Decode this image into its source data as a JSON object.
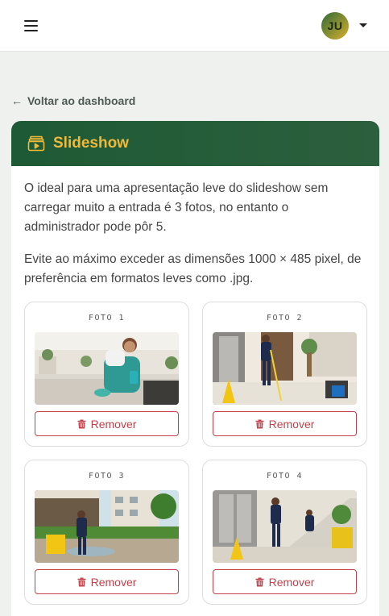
{
  "topbar": {
    "menu_icon": "hamburger-menu-icon",
    "avatar_initials": "JU",
    "dropdown_icon": "caret-down-icon"
  },
  "back_link": {
    "arrow": "←",
    "label": "Voltar ao dashboard"
  },
  "card": {
    "title": "Slideshow",
    "title_icon": "slideshow-icon",
    "header_color": "#1e5a35",
    "title_color": "#f0b93a",
    "description_1": "O ideal para uma apresentação leve do slideshow sem carregar muito a entrada é 3 fotos, no entanto o administrador pode pôr 5.",
    "description_2": "Evite ao máximo exceder as dimensões 1000 × 485 pixel, de preferência em formatos leves como .jpg."
  },
  "photos": [
    {
      "label": "FOTO 1",
      "remove_label": "Remover"
    },
    {
      "label": "FOTO 2",
      "remove_label": "Remover"
    },
    {
      "label": "FOTO 3",
      "remove_label": "Remover"
    },
    {
      "label": "FOTO 4",
      "remove_label": "Remover"
    }
  ],
  "danger_color": "#c0414a"
}
